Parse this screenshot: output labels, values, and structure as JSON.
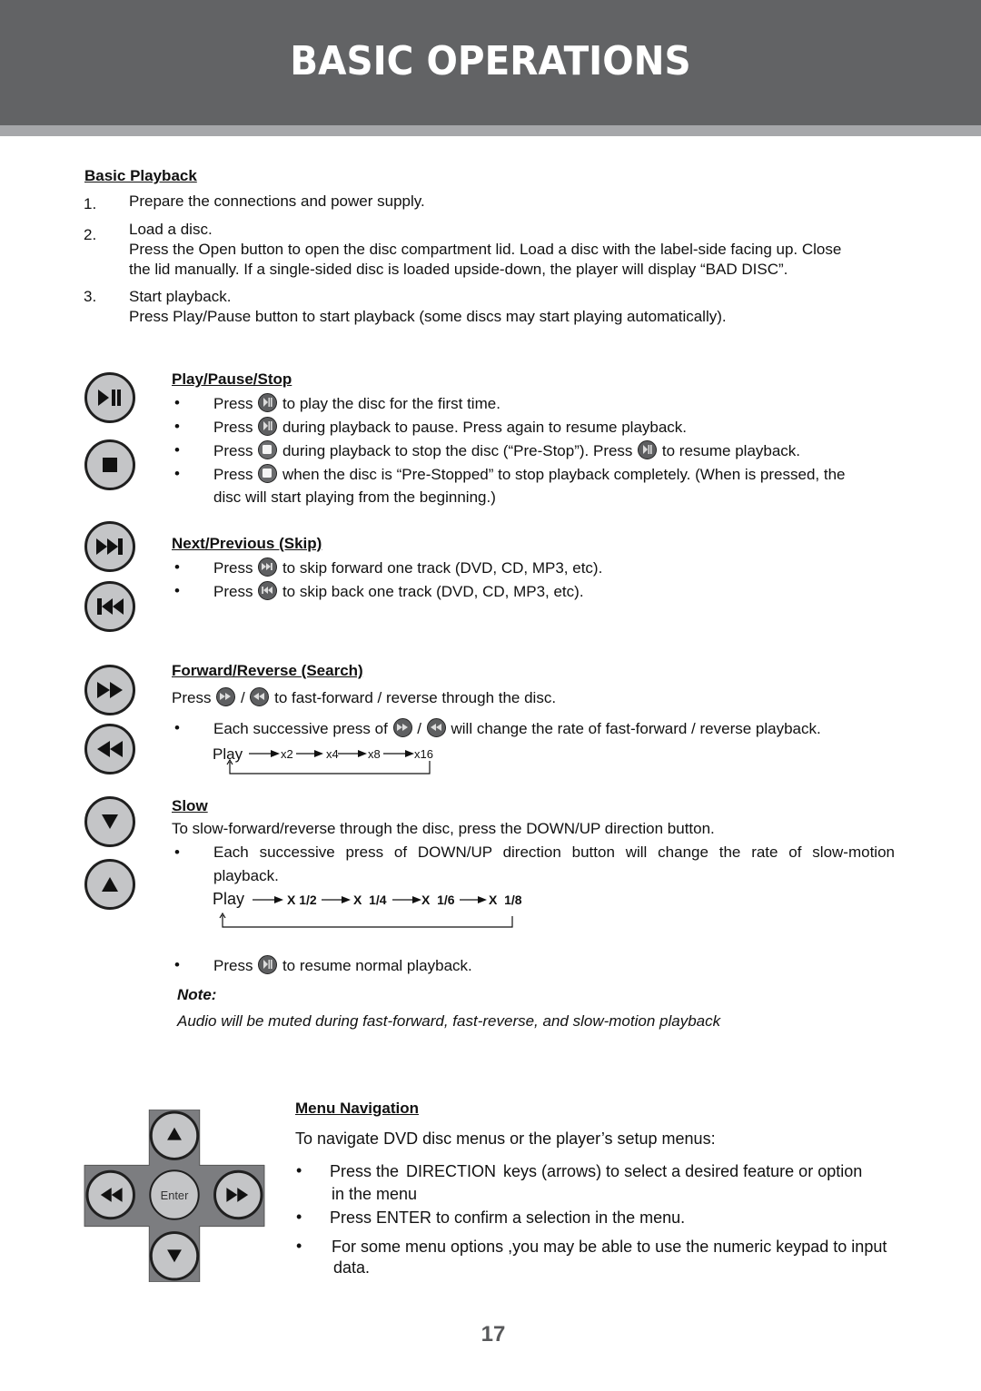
{
  "header": {
    "title": "BASIC OPERATIONS"
  },
  "basic_playback": {
    "heading": "Basic Playback",
    "steps": [
      {
        "num": "1.",
        "title": "Prepare the connections and power supply.",
        "lines": []
      },
      {
        "num": "2.",
        "title": "Load a disc.",
        "lines": [
          "Press the Open button to open the disc compartment lid. Load a disc with the label-side facing up. Close",
          "the lid manually. If a single-sided disc is loaded upside-down, the player will display “BAD DISC”."
        ]
      },
      {
        "num": "3.",
        "title": "Start playback.",
        "lines": [
          "Press Play/Pause button to start playback (some discs may start playing automatically)."
        ]
      }
    ]
  },
  "play_pause_stop": {
    "heading": "Play/Pause/Stop",
    "bullet": "•",
    "items": [
      {
        "pre": "Press",
        "icon": "play-pause-icon",
        "post": "to play the disc for the first time."
      },
      {
        "pre": "Press",
        "icon": "play-pause-icon",
        "post": "during playback to pause. Press again to resume playback."
      },
      {
        "pre": "Press",
        "icon": "stop-icon",
        "post": " during playback to stop the disc (“Pre-Stop”). Press",
        "icon2": "play-pause-icon",
        "post2": "to resume playback."
      },
      {
        "pre": "Press",
        "icon": "stop-icon",
        "post": "when the disc is “Pre-Stopped” to stop playback completely. (When is pressed, the",
        "cont": "disc will start playing from the beginning.)"
      }
    ]
  },
  "skip": {
    "heading": "Next/Previous (Skip)",
    "items": [
      {
        "pre": "Press",
        "icon": "next-track-icon",
        "post": "to skip forward one track (DVD, CD, MP3, etc)."
      },
      {
        "pre": "Press",
        "icon": "previous-track-icon",
        "post": "to skip back one track (DVD, CD, MP3, etc)."
      }
    ]
  },
  "search": {
    "heading": "Forward/Reverse (Search)",
    "intro_pre": "Press",
    "intro_sep": "/",
    "intro_post": "to fast-forward / reverse through the disc.",
    "bullet_pre": "Each successive press of",
    "bullet_sep": "/",
    "bullet_post": "will change the rate of fast-forward / reverse playback.",
    "flow": [
      "Play",
      "x2",
      "x4",
      "x8",
      "x16"
    ]
  },
  "slow": {
    "heading": "Slow",
    "intro": "To slow-forward/reverse through the disc, press the DOWN/UP direction button.",
    "bullet_line1": "Each successive press of DOWN/UP direction button will change the rate of slow-motion",
    "bullet_line2": "playback.",
    "flow": [
      "Play",
      "X 1/2",
      "X  1/4",
      "X  1/6",
      "X  1/8"
    ],
    "resume_pre": "Press",
    "resume_post": "to resume normal playback."
  },
  "note": {
    "label": "Note:",
    "text": "Audio will be muted during fast-forward, fast-reverse, and slow-motion playback"
  },
  "menu_navigation": {
    "heading": "Menu Navigation",
    "intro": "To navigate DVD disc menus or the player’s setup menus:",
    "items": [
      {
        "line1_a": "Press the ",
        "line1_key": "DIRECTION",
        "line1_b": " keys (arrows) to select a desired feature or option",
        "line2": "in the menu"
      },
      {
        "line1_a": "Press ENTER to confirm a selection in the menu."
      },
      {
        "line1_a": "For some menu options ,you may be able to use the numeric keypad to input",
        "line2": "data."
      }
    ],
    "dpad_enter_label": "Enter"
  },
  "page_number": "17"
}
